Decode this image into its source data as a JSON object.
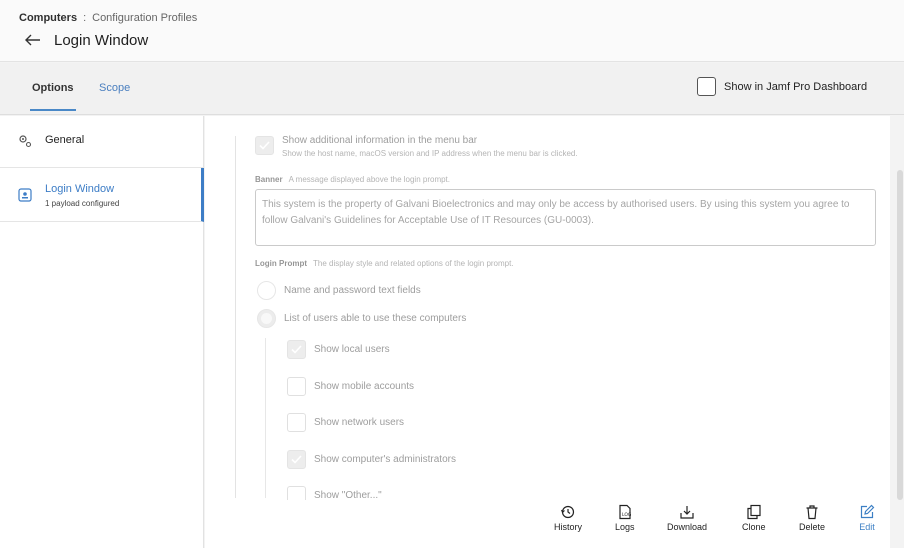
{
  "breadcrumb": {
    "root": "Computers",
    "separator": ":",
    "current": "Configuration Profiles"
  },
  "page": {
    "title": "Login Window"
  },
  "tabs": [
    {
      "label": "Options",
      "active": true
    },
    {
      "label": "Scope",
      "active": false
    }
  ],
  "dashboard_toggle": {
    "label": "Show in Jamf Pro Dashboard",
    "checked": false
  },
  "sidebar": {
    "items": [
      {
        "label": "General",
        "sublabel": "",
        "icon": "gear-icon"
      },
      {
        "label": "Login Window",
        "sublabel": "1 payload configured",
        "icon": "login-window-icon",
        "selected": true
      }
    ]
  },
  "form": {
    "menu_bar": {
      "label": "Show additional information in the menu bar",
      "description": "Show the host name, macOS version and IP address when the menu bar is clicked.",
      "checked": true
    },
    "banner": {
      "label": "Banner",
      "description": "A message displayed above the login prompt.",
      "value": "This system is the property of Galvani Bioelectronics and may only be access by authorised users. By using this system you agree to follow Galvani's Guidelines for Acceptable Use of IT Resources (GU-0003)."
    },
    "login_prompt": {
      "label": "Login Prompt",
      "description": "The display style and related options of the login prompt.",
      "options": [
        {
          "label": "Name and password text fields",
          "checked": false
        },
        {
          "label": "List of users able to use these computers",
          "checked": true
        }
      ]
    },
    "user_list_options": [
      {
        "label": "Show local users",
        "checked": true
      },
      {
        "label": "Show mobile accounts",
        "checked": false
      },
      {
        "label": "Show network users",
        "checked": false
      },
      {
        "label": "Show computer's administrators",
        "checked": true
      },
      {
        "label": "Show \"Other...\"",
        "checked": false
      }
    ]
  },
  "actions": [
    {
      "label": "History",
      "icon": "history-icon"
    },
    {
      "label": "Logs",
      "icon": "logs-icon"
    },
    {
      "label": "Download",
      "icon": "download-icon"
    },
    {
      "label": "Clone",
      "icon": "clone-icon"
    },
    {
      "label": "Delete",
      "icon": "delete-icon"
    },
    {
      "label": "Edit",
      "icon": "edit-icon"
    }
  ],
  "colors": {
    "accent": "#3d7dc6",
    "selected_border": "#3d7dc6"
  }
}
